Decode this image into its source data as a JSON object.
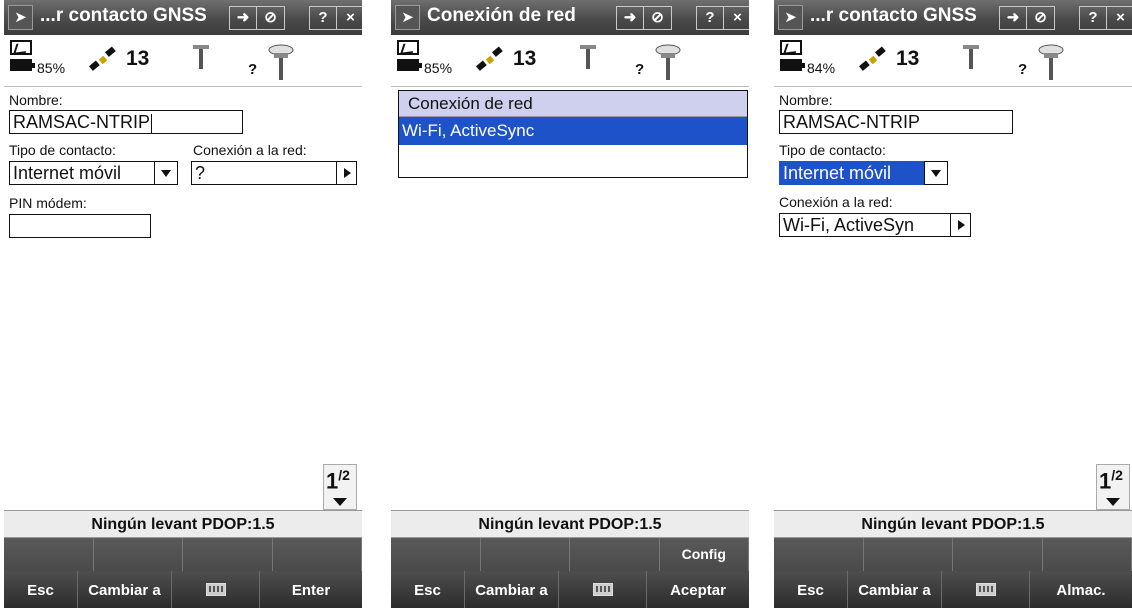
{
  "colors": {
    "titlebar": "#4a4a4a",
    "selection": "#1e52c8",
    "list_header": "#cfd0ee",
    "softkey_bar": "#4a4a4a"
  },
  "screens": [
    {
      "title": "...r contacto GNSS",
      "title_buttons": {
        "a": "➜",
        "b": "⊘",
        "help": "?",
        "close": "×"
      },
      "status": {
        "battery": "85%",
        "satellites": "13",
        "unknown": "?"
      },
      "form": {
        "nombre_label": "Nombre:",
        "nombre_value": "RAMSAC-NTRIP",
        "tipo_label": "Tipo de contacto:",
        "tipo_value": "Internet móvil",
        "conexion_label": "Conexión a la red:",
        "conexion_value": "?",
        "pin_label": "PIN módem:",
        "pin_value": ""
      },
      "pager": {
        "num": "1",
        "den": "2"
      },
      "info": "Ningún levant  PDOP:1.5",
      "softkeys": [
        "",
        "",
        "",
        ""
      ],
      "fnkeys": [
        "Esc",
        "Cambiar a",
        "keyboard-icon",
        "Enter"
      ]
    },
    {
      "title": "Conexión de red",
      "title_buttons": {
        "a": "➜",
        "b": "⊘",
        "help": "?",
        "close": "×"
      },
      "status": {
        "battery": "85%",
        "satellites": "13",
        "unknown": "?"
      },
      "list": {
        "header": "Conexión de red",
        "items": [
          "Wi-Fi, ActiveSync"
        ]
      },
      "info": "Ningún levant  PDOP:1.5",
      "softkeys": [
        "",
        "",
        "",
        "Config"
      ],
      "fnkeys": [
        "Esc",
        "Cambiar a",
        "keyboard-icon",
        "Aceptar"
      ]
    },
    {
      "title": "...r contacto GNSS",
      "title_buttons": {
        "a": "➜",
        "b": "⊘",
        "help": "?",
        "close": "×"
      },
      "status": {
        "battery": "84%",
        "satellites": "13",
        "unknown": "?"
      },
      "form": {
        "nombre_label": "Nombre:",
        "nombre_value": "RAMSAC-NTRIP",
        "tipo_label": "Tipo de contacto:",
        "tipo_value": "Internet móvil",
        "conexion_label": "Conexión a la red:",
        "conexion_value": "Wi-Fi, ActiveSyn"
      },
      "pager": {
        "num": "1",
        "den": "2"
      },
      "info": "Ningún levant  PDOP:1.5",
      "softkeys": [
        "",
        "",
        "",
        ""
      ],
      "fnkeys": [
        "Esc",
        "Cambiar a",
        "keyboard-icon",
        "Almac."
      ]
    }
  ]
}
